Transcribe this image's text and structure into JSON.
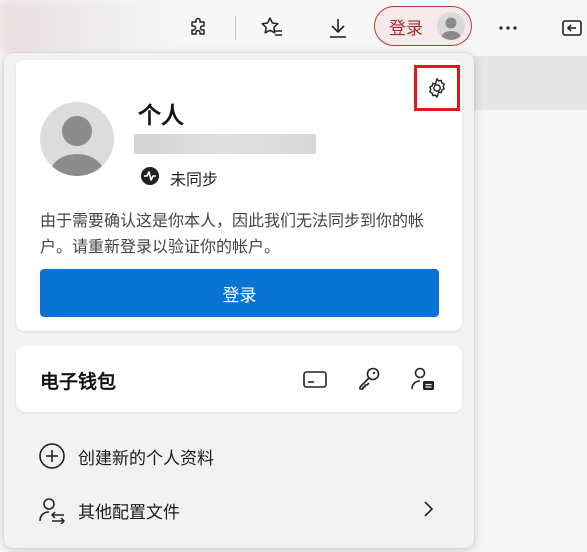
{
  "toolbar": {
    "extensions_icon": "puzzle-icon",
    "favorites_icon": "star-list-icon",
    "downloads_icon": "download-icon",
    "signin_label": "登录",
    "more_icon": "ellipsis-icon",
    "sidebar_icon": "exit-sidebar-icon"
  },
  "profile": {
    "name": "个人",
    "sync_status": "未同步",
    "message": "由于需要确认这是你本人，因此我们无法同步到你的帐户。请重新登录以验证你的帐户。",
    "signin_button": "登录",
    "settings_icon": "gear-icon"
  },
  "wallet": {
    "title": "电子钱包",
    "icons": [
      "credit-card-icon",
      "key-icon",
      "person-badge-icon"
    ]
  },
  "menu": {
    "create_profile": "创建新的个人资料",
    "other_profiles": "其他配置文件"
  },
  "colors": {
    "accent": "#0a74d4",
    "signin_pill_border": "#b33a3a",
    "highlight_box": "#e01818"
  }
}
